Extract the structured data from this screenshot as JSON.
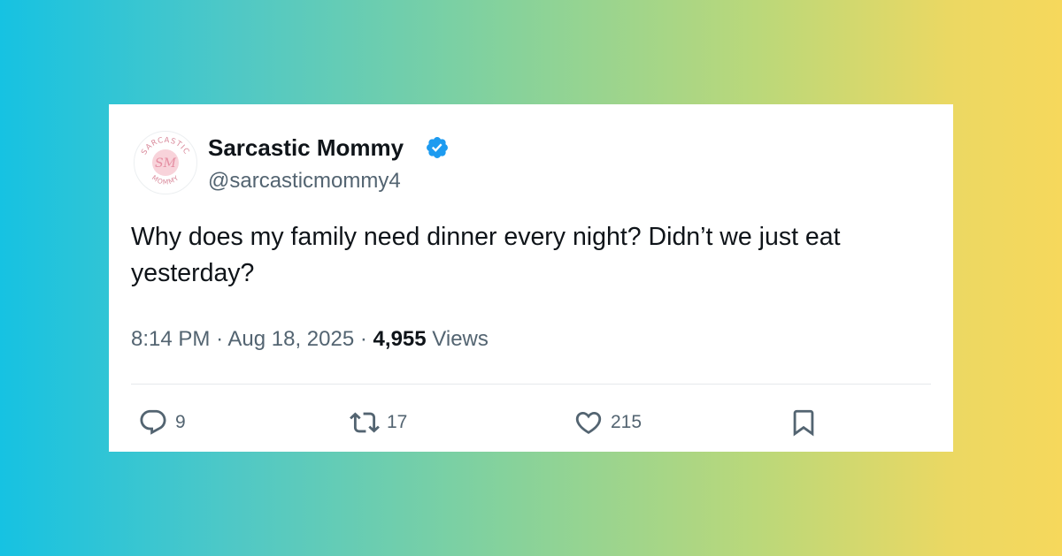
{
  "tweet": {
    "author": {
      "display_name": "Sarcastic Mommy",
      "handle": "@sarcasticmommy4",
      "verified": true,
      "avatar": {
        "top_text": "SARCASTIC",
        "bottom_text": "MOMMY",
        "monogram": "SM",
        "bg_color": "#f8d3da",
        "text_color": "#e58ea2"
      }
    },
    "text": "Why does my family need dinner every night? Didn’t we just eat yesterday?",
    "time": "8:14 PM",
    "date": "Aug 18, 2025",
    "separator": "·",
    "views_count": "4,955",
    "views_label": "Views",
    "actions": {
      "replies": "9",
      "reposts": "17",
      "likes": "215",
      "bookmark_icon": "bookmark-icon"
    }
  },
  "colors": {
    "verified_blue": "#1d9bf0",
    "text_primary": "#0f1419",
    "text_secondary": "#536471",
    "background_gradient": [
      "#16c2e2",
      "#86d29b",
      "#f6d85c"
    ]
  }
}
